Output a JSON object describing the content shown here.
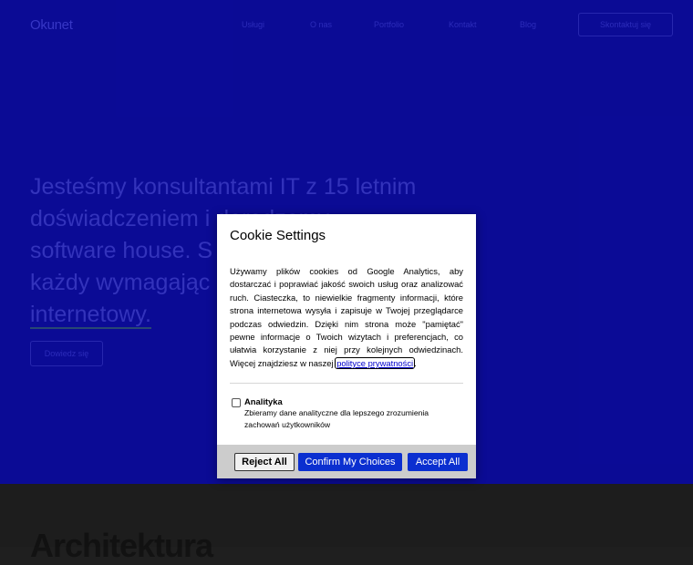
{
  "site": {
    "brand": "Okunet",
    "nav": [
      "Usługi",
      "O nas",
      "Portfolio",
      "Kontakt",
      "Blog"
    ],
    "nav_button": "Skontaktuj się",
    "headline_lines": [
      "Jesteśmy konsultantami IT z 15 letnim",
      "doświadczeniem i doradzamy,",
      "software house. S",
      "każdy wymagając",
      "internetowy."
    ],
    "cta": "Dowiedz się",
    "section_title": "Architektura"
  },
  "cookie": {
    "title": "Cookie Settings",
    "body": "Używamy plików cookies od Google Analytics, aby dostarczać i poprawiać jakość swoich usług oraz analizować ruch. Ciasteczka, to niewielkie fragmenty informacji, które strona internetowa wysyła i zapisuje w Twojej przeglądarce podczas odwiedzin. Dzięki nim strona może \"pamiętać\" pewne informacje o Twoich wizytach i preferencjach, co ułatwia korzystanie z niej przy kolejnych odwiedzinach. Więcej znajdziesz w naszej",
    "policy_link": "polityce prywatności",
    "option_title": "Analityka",
    "option_desc": "Zbieramy dane analityczne dla lepszego zrozumienia zachowań użytkowników",
    "option_checked": false,
    "reject": "Reject All",
    "confirm": "Confirm My Choices",
    "accept": "Accept All"
  },
  "colors": {
    "hero_bg": "#0c0c9e",
    "primary_button": "#0b2fd0",
    "footer_bg": "#cccccc"
  }
}
